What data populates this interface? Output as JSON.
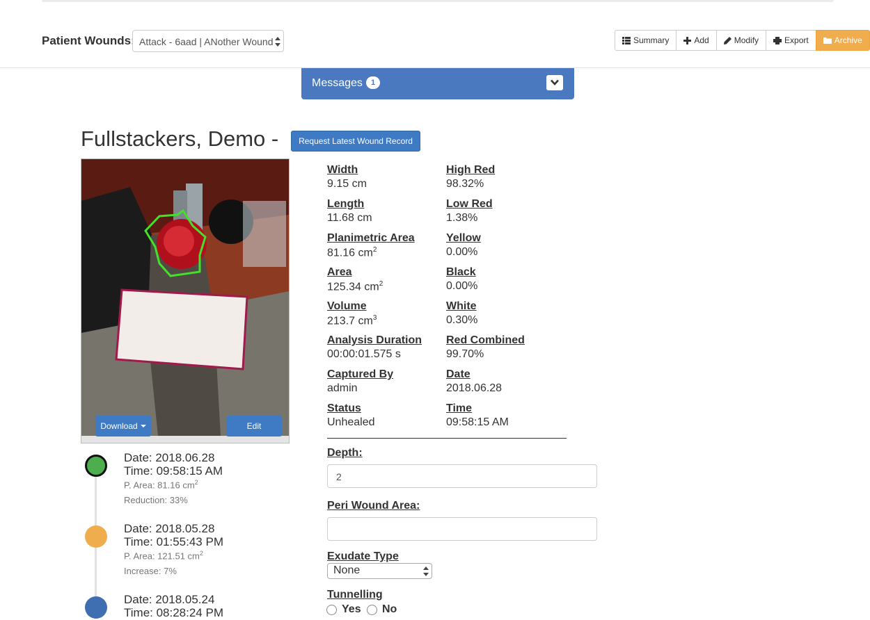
{
  "header": {
    "patient_wounds_label": "Patient Wounds:",
    "wound_select_value": "Attack - 6aad | ANother Wound",
    "buttons": [
      {
        "label": "Summary",
        "icon": "list-icon"
      },
      {
        "label": "Add",
        "icon": "plus-icon"
      },
      {
        "label": "Modify",
        "icon": "pencil-icon"
      },
      {
        "label": "Export",
        "icon": "print-icon"
      },
      {
        "label": "Archive",
        "icon": "folder-icon"
      }
    ],
    "archive_color": "#f0ad4e"
  },
  "messages": {
    "title": "Messages",
    "count": "1",
    "color": "#4a79bf"
  },
  "patient": {
    "name": "Fullstackers, Demo -",
    "request_button": "Request Latest Wound Record"
  },
  "photo": {
    "download_label": "Download",
    "edit_label": "Edit"
  },
  "metrics": {
    "width": {
      "label": "Width",
      "value": "9.15 cm"
    },
    "high_red": {
      "label": "High Red",
      "value": "98.32%"
    },
    "length": {
      "label": "Length",
      "value": "11.68 cm"
    },
    "low_red": {
      "label": "Low Red",
      "value": "1.38%"
    },
    "planimetric_area": {
      "label": "Planimetric Area",
      "value": "81.16 cm",
      "sup": "2"
    },
    "yellow": {
      "label": "Yellow",
      "value": "0.00%"
    },
    "area": {
      "label": "Area",
      "value": "125.34 cm",
      "sup": "2"
    },
    "black": {
      "label": "Black",
      "value": "0.00%"
    },
    "volume": {
      "label": "Volume",
      "value": "213.7 cm",
      "sup": "3"
    },
    "white": {
      "label": "White",
      "value": "0.30%"
    },
    "analysis_duration": {
      "label": "Analysis Duration",
      "value": "00:00:01.575 s"
    },
    "red_combined": {
      "label": "Red Combined",
      "value": "99.70%"
    },
    "captured_by": {
      "label": "Captured By",
      "value": "admin"
    },
    "date": {
      "label": "Date",
      "value": "2018.06.28"
    },
    "status": {
      "label": "Status",
      "value": "Unhealed"
    },
    "time": {
      "label": "Time",
      "value": "09:58:15 AM"
    }
  },
  "form": {
    "depth_label": "Depth:",
    "depth_value": "2",
    "peri_label": "Peri Wound Area:",
    "peri_value": "",
    "exudate_label": "Exudate Type",
    "exudate_value": "None",
    "tunnelling_label": "Tunnelling",
    "yes_label": "Yes",
    "no_label": "No"
  },
  "timeline": [
    {
      "date": "Date: 2018.06.28",
      "time": "Time: 09:58:15 AM",
      "area": "P. Area: 81.16 cm",
      "area_sup": "2",
      "change": "Reduction: 33%",
      "color": "#4cae4c"
    },
    {
      "date": "Date: 2018.05.28",
      "time": "Time: 01:55:43 PM",
      "area": "P. Area: 121.51 cm",
      "area_sup": "2",
      "change": "Increase: 7%",
      "color": "#f0ad4e"
    },
    {
      "date": "Date: 2018.05.24",
      "time": "Time: 08:28:24 PM",
      "color": "#3f6fb0"
    }
  ]
}
